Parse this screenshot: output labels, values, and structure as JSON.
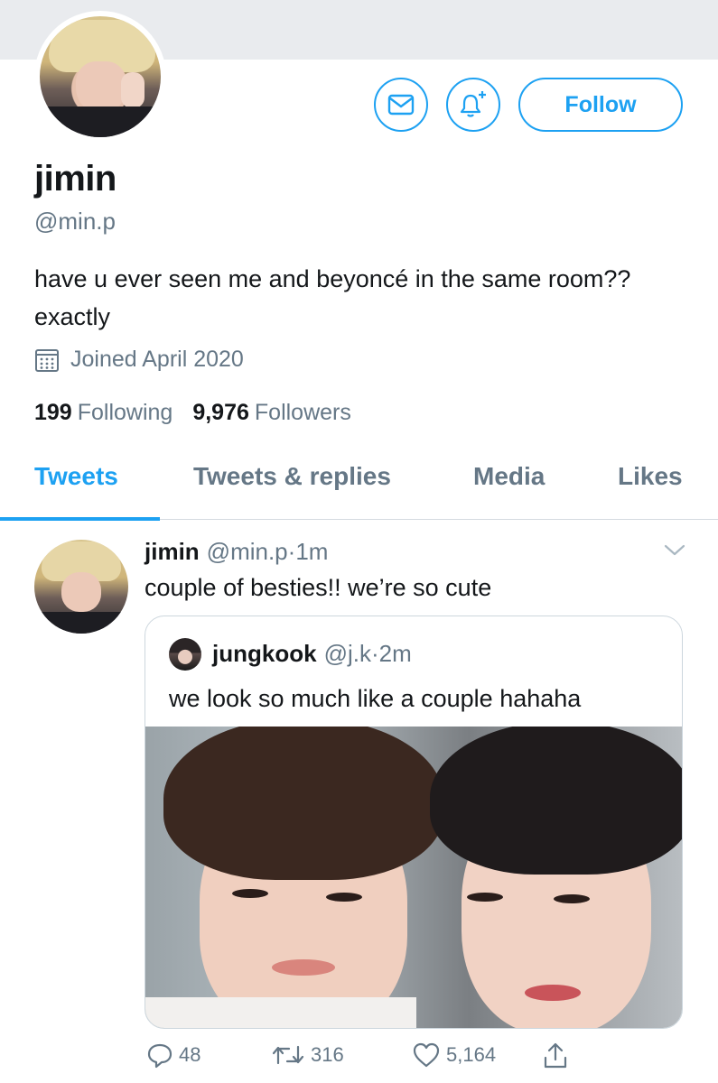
{
  "profile": {
    "name": "jimin",
    "handle": "@min.p",
    "bio": "have u ever seen me and beyoncé in the same room?? exactly",
    "joined": "Joined April 2020",
    "following_count": "199",
    "following_label": "Following",
    "followers_count": "9,976",
    "followers_label": "Followers",
    "follow_label": "Follow"
  },
  "tabs": [
    {
      "label": "Tweets",
      "active": true
    },
    {
      "label": "Tweets & replies",
      "active": false
    },
    {
      "label": "Media",
      "active": false
    },
    {
      "label": "Likes",
      "active": false
    }
  ],
  "tweet": {
    "name": "jimin",
    "handle": "@min.p",
    "time": "1m",
    "text": "couple of besties!! we’re so cute",
    "quoted": {
      "name": "jungkook",
      "handle": "@j.k",
      "time": "2m",
      "text": "we look so much like a couple hahaha"
    },
    "replies": "48",
    "retweets": "316",
    "likes": "5,164"
  },
  "colors": {
    "accent": "#1da1f2",
    "muted": "#657786",
    "text": "#14171a",
    "banner": "#e9ebee"
  },
  "icons": [
    "mail-icon",
    "bell-plus-icon",
    "calendar-icon",
    "chevron-down-icon",
    "reply-icon",
    "retweet-icon",
    "like-icon",
    "share-icon"
  ]
}
